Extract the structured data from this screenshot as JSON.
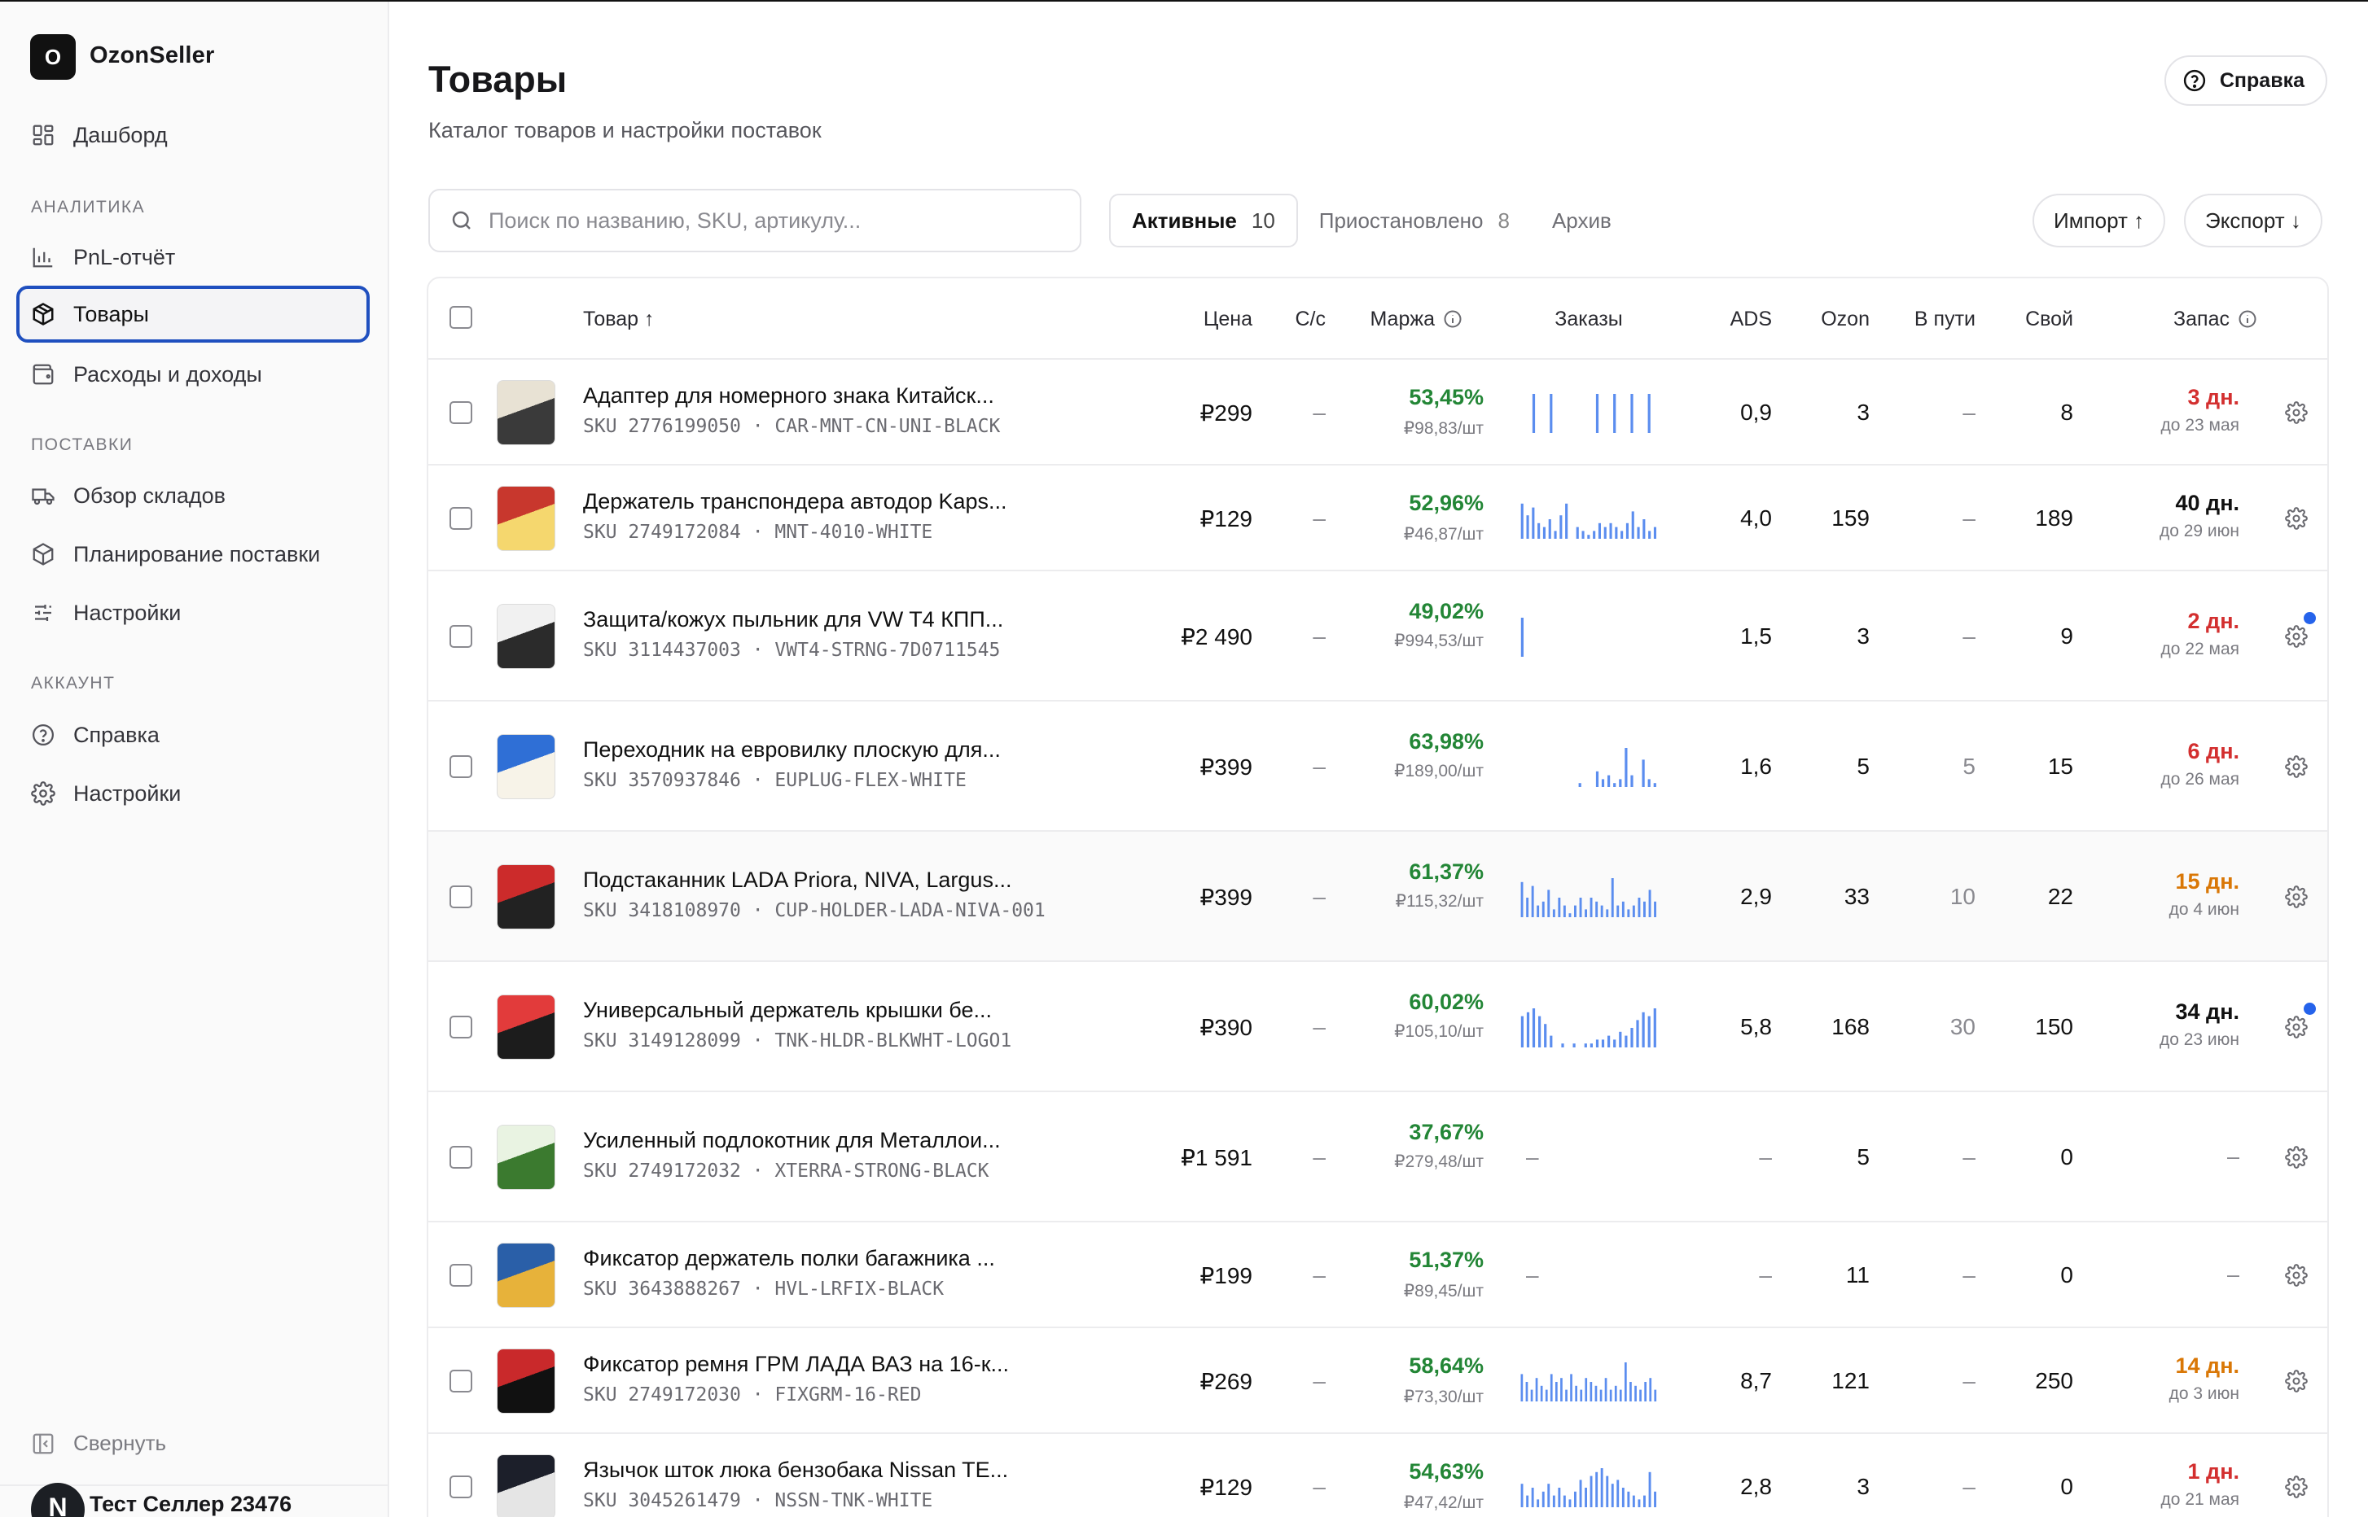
{
  "app": {
    "logo_letter": "O",
    "name": "OzonSeller"
  },
  "sidebar": {
    "dashboard": "Дашборд",
    "sections": {
      "analytics": "АНАЛИТИКА",
      "supply": "ПОСТАВКИ",
      "account": "АККАУНТ"
    },
    "items": {
      "pnl": "PnL-отчёт",
      "products": "Товары",
      "expenses": "Расходы и доходы",
      "warehouses": "Обзор складов",
      "planning": "Планирование поставки",
      "settings1": "Настройки",
      "help": "Справка",
      "settings2": "Настройки"
    },
    "collapse": "Свернуть",
    "user": {
      "initial": "N",
      "name": "Тест Селлер 23476"
    }
  },
  "header": {
    "title": "Товары",
    "subtitle": "Каталог товаров и настройки поставок",
    "help": "Справка"
  },
  "toolbar": {
    "search_placeholder": "Поиск по названию, SKU, артикулу...",
    "tabs": [
      {
        "label": "Активные",
        "count": "10"
      },
      {
        "label": "Приостановлено",
        "count": "8"
      },
      {
        "label": "Архив",
        "count": ""
      }
    ],
    "import": "Импорт ↑",
    "export": "Экспорт ↓"
  },
  "table": {
    "columns": {
      "product": "Товар ↑",
      "price": "Цена",
      "cost": "С/с",
      "margin": "Маржа",
      "orders": "Заказы",
      "ads": "ADS",
      "ozon": "Ozon",
      "transit": "В пути",
      "own": "Свой",
      "stock": "Запас"
    },
    "accent_color": "#5b8def",
    "rows": [
      {
        "name": "Адаптер для номерного знака Китайск...",
        "sku": "SKU 2776199050 · CAR-MNT-CN-UNI-BLACK",
        "price": "₽299",
        "cost": "–",
        "margin": "53,45%",
        "margin_sub": "₽98,83/шт",
        "orders": [
          0,
          0,
          1,
          0,
          0,
          1,
          0,
          0,
          0,
          0,
          0,
          0,
          0,
          1,
          0,
          0,
          1,
          0,
          0,
          1,
          0,
          0,
          1,
          0
        ],
        "ads": "0,9",
        "ozon": "3",
        "transit": "–",
        "own": "8",
        "stock": "3 дн.",
        "stock_sub": "до 23 мая",
        "stock_level": "red",
        "dot": false
      },
      {
        "name": "Держатель транспондера автодор Kaps...",
        "sku": "SKU 2749172084 · MNT-4010-WHITE",
        "price": "₽129",
        "cost": "–",
        "margin": "52,96%",
        "margin_sub": "₽46,87/шт",
        "orders": [
          0.9,
          0.6,
          0.8,
          0.4,
          0.3,
          0.5,
          0.2,
          0.6,
          0.9,
          0,
          0.3,
          0.2,
          0.1,
          0.2,
          0.4,
          0.3,
          0.4,
          0.3,
          0.2,
          0.4,
          0.7,
          0.3,
          0.5,
          0.2,
          0.3
        ],
        "ads": "4,0",
        "ozon": "159",
        "transit": "–",
        "own": "189",
        "stock": "40 дн.",
        "stock_sub": "до 29 июн",
        "stock_level": "black",
        "dot": false
      },
      {
        "name": "Защита/кожух пыльник для VW T4 КПП...",
        "sku": "SKU 3114437003 · VWT4-STRNG-7D0711545",
        "price": "₽2 490",
        "cost": "–",
        "margin": "49,02%",
        "margin_sub": "₽994,53/шт",
        "orders": [
          1,
          0,
          0,
          0,
          0,
          0,
          0,
          0,
          0,
          0,
          0,
          0,
          0,
          0,
          0,
          0,
          0,
          0,
          0,
          0,
          0,
          0,
          0,
          0
        ],
        "ads": "1,5",
        "ozon": "3",
        "transit": "–",
        "own": "9",
        "stock": "2 дн.",
        "stock_sub": "до 22 мая",
        "stock_level": "red",
        "dot": true
      },
      {
        "name": "Переходник на евровилку плоскую для...",
        "sku": "SKU 3570937846 · EUPLUG-FLEX-WHITE",
        "price": "₽399",
        "cost": "–",
        "margin": "63,98%",
        "margin_sub": "₽189,00/шт",
        "orders": [
          0,
          0,
          0,
          0,
          0,
          0,
          0,
          0,
          0,
          0,
          0.1,
          0,
          0,
          0.4,
          0.2,
          0.3,
          0.1,
          0.2,
          1,
          0.3,
          0,
          0.7,
          0.2,
          0.1
        ],
        "ads": "1,6",
        "ozon": "5",
        "transit": "5",
        "own": "15",
        "stock": "6 дн.",
        "stock_sub": "до 26 мая",
        "stock_level": "red",
        "dot": false
      },
      {
        "name": "Подстаканник LADA Priora, NIVA, Largus...",
        "sku": "SKU 3418108970 · CUP-HOLDER-LADA-NIVA-001",
        "price": "₽399",
        "cost": "–",
        "margin": "61,37%",
        "margin_sub": "₽115,32/шт",
        "orders": [
          0.9,
          0.5,
          0.8,
          0.3,
          0.4,
          0.7,
          0.2,
          0.5,
          0.3,
          0.1,
          0.3,
          0.5,
          0.2,
          0.5,
          0.4,
          0.3,
          0.2,
          1,
          0.3,
          0.4,
          0.2,
          0.3,
          0.5,
          0.4,
          0.7,
          0.4
        ],
        "ads": "2,9",
        "ozon": "33",
        "transit": "10",
        "own": "22",
        "stock": "15 дн.",
        "stock_sub": "до 4 июн",
        "stock_level": "orange",
        "dot": false
      },
      {
        "name": "Универсальный держатель крышки бе...",
        "sku": "SKU 3149128099 · TNK-HLDR-BLKWHT-LOGO1",
        "price": "₽390",
        "cost": "–",
        "margin": "60,02%",
        "margin_sub": "₽105,10/шт",
        "orders": [
          0.8,
          0.9,
          1,
          0.8,
          0.6,
          0.3,
          0,
          0.1,
          0,
          0.1,
          0,
          0.1,
          0.1,
          0.2,
          0.2,
          0.3,
          0.2,
          0.4,
          0.3,
          0.5,
          0.7,
          0.9,
          0.8,
          1
        ],
        "ads": "5,8",
        "ozon": "168",
        "transit": "30",
        "own": "150",
        "stock": "34 дн.",
        "stock_sub": "до 23 июн",
        "stock_level": "black",
        "dot": true
      },
      {
        "name": "Усиленный подлокотник для Металлои...",
        "sku": "SKU 2749172032 · XTERRA-STRONG-BLACK",
        "price": "₽1 591",
        "cost": "–",
        "margin": "37,67%",
        "margin_sub": "₽279,48/шт",
        "orders_text": "–",
        "orders": [],
        "ads": "–",
        "ozon": "5",
        "transit": "–",
        "own": "0",
        "stock": "–",
        "stock_sub": "",
        "stock_level": "none",
        "dot": false
      },
      {
        "name": "Фиксатор держатель полки багажника ...",
        "sku": "SKU 3643888267 · HVL-LRFIX-BLACK",
        "price": "₽199",
        "cost": "–",
        "margin": "51,37%",
        "margin_sub": "₽89,45/шт",
        "orders_text": "–",
        "orders": [],
        "ads": "–",
        "ozon": "11",
        "transit": "–",
        "own": "0",
        "stock": "–",
        "stock_sub": "",
        "stock_level": "none",
        "dot": false
      },
      {
        "name": "Фиксатор ремня ГРМ ЛАДА ВАЗ на 16-к...",
        "sku": "SKU 2749172030 · FIXGRM-16-RED",
        "price": "₽269",
        "cost": "–",
        "margin": "58,64%",
        "margin_sub": "₽73,30/шт",
        "orders": [
          0.7,
          0.5,
          0.3,
          0.6,
          0.4,
          0.3,
          0.7,
          0.5,
          0.6,
          0.3,
          0.7,
          0.4,
          0.3,
          0.6,
          0.5,
          0.4,
          0.3,
          0.6,
          0.3,
          0.4,
          0.3,
          1,
          0.5,
          0.4,
          0.3,
          0.5,
          0.6,
          0.3
        ],
        "ads": "8,7",
        "ozon": "121",
        "transit": "–",
        "own": "250",
        "stock": "14 дн.",
        "stock_sub": "до 3 июн",
        "stock_level": "orange",
        "dot": false
      },
      {
        "name": "Язычок шток люка бензобака Nissan TE...",
        "sku": "SKU 3045261479 · NSSN-TNK-WHITE",
        "price": "₽129",
        "cost": "–",
        "margin": "54,63%",
        "margin_sub": "₽47,42/шт",
        "orders": [
          0.6,
          0.3,
          0.5,
          0.2,
          0.4,
          0.6,
          0.3,
          0.5,
          0.3,
          0.2,
          0.4,
          0.7,
          0.5,
          0.8,
          0.9,
          1,
          0.8,
          0.6,
          0.7,
          0.5,
          0.4,
          0.3,
          0.2,
          0.3,
          0.9,
          0.4
        ],
        "ads": "2,8",
        "ozon": "3",
        "transit": "–",
        "own": "0",
        "stock": "1 дн.",
        "stock_sub": "до 21 мая",
        "stock_level": "red",
        "dot": false
      }
    ]
  }
}
